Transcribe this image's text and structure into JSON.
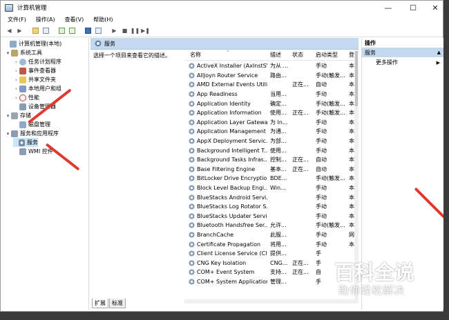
{
  "window": {
    "title": "计算机管理",
    "controls": [
      "—",
      "☐",
      "✕"
    ]
  },
  "menu": [
    "文件(F)",
    "操作(A)",
    "查看(V)",
    "帮助(H)"
  ],
  "tree": [
    {
      "label": "计算机管理(本地)",
      "level": 0,
      "arrow": "",
      "icon": "computer-icon",
      "selected": false
    },
    {
      "label": "系统工具",
      "level": 1,
      "arrow": "▾",
      "icon": "tools-icon",
      "selected": false
    },
    {
      "label": "任务计划程序",
      "level": 2,
      "arrow": "›",
      "icon": "clock-icon",
      "selected": false
    },
    {
      "label": "事件查看器",
      "level": 2,
      "arrow": "›",
      "icon": "event-viewer-icon",
      "selected": false
    },
    {
      "label": "共享文件夹",
      "level": 2,
      "arrow": "›",
      "icon": "shared-folder-icon",
      "selected": false
    },
    {
      "label": "本地用户和组",
      "level": 2,
      "arrow": "›",
      "icon": "users-icon",
      "selected": false
    },
    {
      "label": "性能",
      "level": 2,
      "arrow": "›",
      "icon": "performance-icon",
      "selected": false
    },
    {
      "label": "设备管理器",
      "level": 2,
      "arrow": "",
      "icon": "device-manager-icon",
      "selected": false
    },
    {
      "label": "存储",
      "level": 1,
      "arrow": "▾",
      "icon": "storage-icon",
      "selected": false
    },
    {
      "label": "磁盘管理",
      "level": 2,
      "arrow": "",
      "icon": "disk-icon",
      "selected": false
    },
    {
      "label": "服务和应用程序",
      "level": 1,
      "arrow": "▾",
      "icon": "services-apps-icon",
      "selected": false
    },
    {
      "label": "服务",
      "level": 2,
      "arrow": "",
      "icon": "services-gear-icon",
      "selected": true
    },
    {
      "label": "WMI 控件",
      "level": 2,
      "arrow": "",
      "icon": "wmi-icon",
      "selected": false
    }
  ],
  "center": {
    "header": "服务",
    "description": "选择一个项目来查看它的描述。",
    "columns": [
      "名称",
      "描述",
      "状态",
      "启动类型",
      "登"
    ]
  },
  "services": [
    [
      "ActiveX Installer (AxInstSV)",
      "为从 ...",
      "",
      "手动",
      "本"
    ],
    [
      "AllJoyn Router Service",
      "路由...",
      "",
      "手动(触发...",
      "本"
    ],
    [
      "AMD External Events Utility",
      "",
      "正在...",
      "自动",
      "本"
    ],
    [
      "App Readiness",
      "当用...",
      "",
      "手动",
      "本"
    ],
    [
      "Application Identity",
      "确定...",
      "",
      "手动(触发...",
      "本"
    ],
    [
      "Application Information",
      "使用...",
      "正在...",
      "手动(触发...",
      "本"
    ],
    [
      "Application Layer Gatewa...",
      "为 In...",
      "",
      "手动",
      "本"
    ],
    [
      "Application Management",
      "为通...",
      "",
      "手动",
      "本"
    ],
    [
      "AppX Deployment Servic...",
      "为部...",
      "",
      "手动",
      "本"
    ],
    [
      "Background Intelligent T...",
      "使用...",
      "",
      "手动",
      "本"
    ],
    [
      "Background Tasks Infras...",
      "控制...",
      "正在...",
      "自动",
      "本"
    ],
    [
      "Base Filtering Engine",
      "基本...",
      "正在...",
      "自动",
      "本"
    ],
    [
      "BitLocker Drive Encryptio...",
      "BDE...",
      "",
      "手动(触发...",
      "本"
    ],
    [
      "Block Level Backup Engi...",
      "Win...",
      "",
      "手动",
      "本"
    ],
    [
      "BlueStacks Android Servi...",
      "",
      "",
      "手动",
      "本"
    ],
    [
      "BlueStacks Log Rotator S...",
      "",
      "",
      "手动",
      "本"
    ],
    [
      "BlueStacks Updater Servi...",
      "",
      "",
      "手动",
      "本"
    ],
    [
      "Bluetooth Handsfree Ser...",
      "允许...",
      "",
      "手动(触发...",
      "本"
    ],
    [
      "BranchCache",
      "此服...",
      "",
      "手动",
      "网"
    ],
    [
      "Certificate Propagation",
      "将用...",
      "",
      "手动",
      "本"
    ],
    [
      "Client License Service (Cli...",
      "提供...",
      "",
      "手",
      ""
    ],
    [
      "CNG Key Isolation",
      "CNG...",
      "正在...",
      "手",
      ""
    ],
    [
      "COM+ Event System",
      "支持...",
      "正在...",
      "自",
      ""
    ],
    [
      "COM+ System Application",
      "管理...",
      "",
      "手",
      ""
    ]
  ],
  "tabs": [
    "扩展",
    "标准"
  ],
  "actions": {
    "header": "操作",
    "section": "服务",
    "items": [
      "更多操作"
    ]
  },
  "watermark": {
    "line1": "百科全说",
    "line2": "助你轻松解决"
  },
  "colors": {
    "selection": "#cce4f7",
    "header_bar": "#c4d9ef",
    "arrow": "#e03a2f"
  }
}
